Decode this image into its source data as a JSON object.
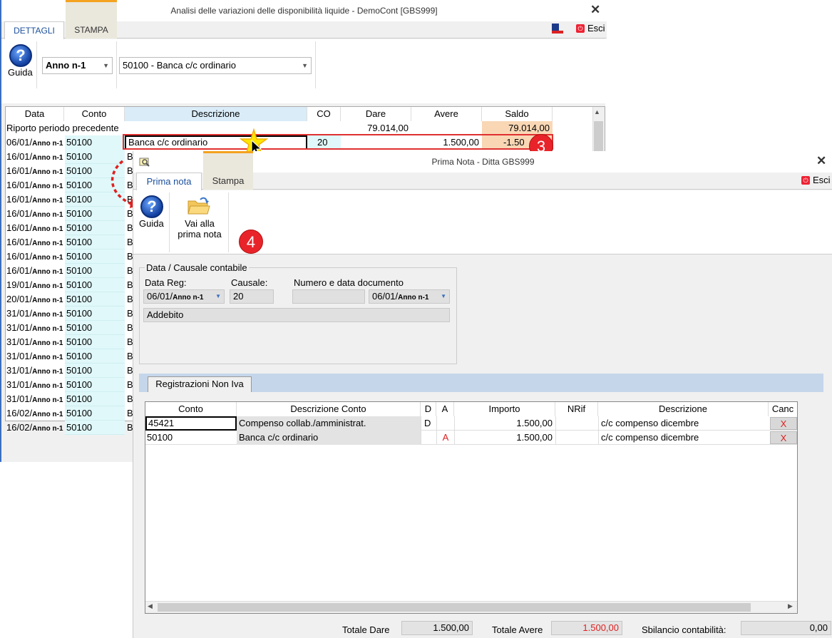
{
  "win1": {
    "title": "Analisi delle variazioni delle disponibilità liquide - DemoCont [GBS999]",
    "tabs": [
      "DETTAGLI",
      "STAMPA"
    ],
    "esci": "Esci",
    "guida": "Guida",
    "anno_combo": "Anno n-1",
    "conto_combo": "50100 - Banca c/c ordinario",
    "headers": [
      "Data",
      "Conto",
      "Descrizione",
      "CO",
      "Dare",
      "Avere",
      "Saldo"
    ],
    "riporto": {
      "label": "Riporto periodo precedente",
      "dare": "79.014,00",
      "saldo": "79.014,00"
    },
    "selected_row": {
      "date": "06/01/",
      "anno": "Anno n-1",
      "conto": "50100",
      "desc": "Banca c/c ordinario",
      "co": "20",
      "avere": "1.500,00",
      "saldo": "-1.50"
    },
    "rows": [
      {
        "date": "16/01/",
        "anno": "Anno n-1",
        "conto": "50100",
        "desc": "B"
      },
      {
        "date": "16/01/",
        "anno": "Anno n-1",
        "conto": "50100",
        "desc": "Ba"
      },
      {
        "date": "16/01/",
        "anno": "Anno n-1",
        "conto": "50100",
        "desc": "Ba"
      },
      {
        "date": "16/01/",
        "anno": "Anno n-1",
        "conto": "50100",
        "desc": "Ba"
      },
      {
        "date": "16/01/",
        "anno": "Anno n-1",
        "conto": "50100",
        "desc": "Ba"
      },
      {
        "date": "16/01/",
        "anno": "Anno n-1",
        "conto": "50100",
        "desc": "Ba"
      },
      {
        "date": "16/01/",
        "anno": "Anno n-1",
        "conto": "50100",
        "desc": "Ba"
      },
      {
        "date": "16/01/",
        "anno": "Anno n-1",
        "conto": "50100",
        "desc": "Ba"
      },
      {
        "date": "16/01/",
        "anno": "Anno n-1",
        "conto": "50100",
        "desc": "Ba"
      },
      {
        "date": "19/01/",
        "anno": "Anno n-1",
        "conto": "50100",
        "desc": "Ba"
      },
      {
        "date": "20/01/",
        "anno": "Anno n-1",
        "conto": "50100",
        "desc": "Ba"
      },
      {
        "date": "31/01/",
        "anno": "Anno n-1",
        "conto": "50100",
        "desc": "Ba"
      },
      {
        "date": "31/01/",
        "anno": "Anno n-1",
        "conto": "50100",
        "desc": "Ba"
      },
      {
        "date": "31/01/",
        "anno": "Anno n-1",
        "conto": "50100",
        "desc": "Ba"
      },
      {
        "date": "31/01/",
        "anno": "Anno n-1",
        "conto": "50100",
        "desc": "Ba"
      },
      {
        "date": "31/01/",
        "anno": "Anno n-1",
        "conto": "50100",
        "desc": "Ba"
      },
      {
        "date": "31/01/",
        "anno": "Anno n-1",
        "conto": "50100",
        "desc": "Ba"
      },
      {
        "date": "31/01/",
        "anno": "Anno n-1",
        "conto": "50100",
        "desc": "Ba"
      },
      {
        "date": "16/02/",
        "anno": "Anno n-1",
        "conto": "50100",
        "desc": "Ba"
      },
      {
        "date": "16/02/",
        "anno": "Anno n-1",
        "conto": "50100",
        "desc": "Ba"
      }
    ],
    "badge": "3"
  },
  "win2": {
    "title": "Prima Nota - Ditta GBS999",
    "tabs": [
      "Prima nota",
      "Stampa"
    ],
    "esci": "Esci",
    "guida": "Guida",
    "vai_line1": "Vai alla",
    "vai_line2": "prima nota",
    "badge": "4",
    "group_title": "Data / Causale contabile",
    "data_reg_label": "Data Reg:",
    "causale_label": "Causale:",
    "numero_label": "Numero e data documento",
    "data_reg_value": "06/01/",
    "data_reg_anno": "Anno n-1",
    "causale_value": "20",
    "numero_value": "",
    "doc_date_value": "06/01/",
    "doc_date_anno": "Anno n-1",
    "causale_desc": "Addebito",
    "inner_tab": "Registrazioni Non Iva",
    "headers": [
      "Conto",
      "Descrizione Conto",
      "D",
      "A",
      "Importo",
      "NRif",
      "Descrizione",
      "Canc"
    ],
    "rows": [
      {
        "conto": "45421",
        "desc": "Compenso collab./amministrat.",
        "d": "D",
        "a": "",
        "importo": "1.500,00",
        "nrif": "",
        "descr": "c/c compenso dicembre",
        "canc": "X"
      },
      {
        "conto": "50100",
        "desc": "Banca c/c ordinario",
        "d": "",
        "a": "A",
        "importo": "1.500,00",
        "nrif": "",
        "descr": "c/c compenso dicembre",
        "canc": "X"
      }
    ],
    "totale_dare_label": "Totale Dare",
    "totale_dare": "1.500,00",
    "totale_avere_label": "Totale Avere",
    "totale_avere": "1.500,00",
    "sbilancio_label": "Sbilancio contabilità:",
    "sbilancio": "0,00"
  },
  "colors": {
    "accent": "#1b4f9c",
    "orange": "#f4a21f",
    "red": "#e8242a",
    "cyan_cell": "#e0f8fa",
    "saldo_cell": "#f9d7b5"
  }
}
